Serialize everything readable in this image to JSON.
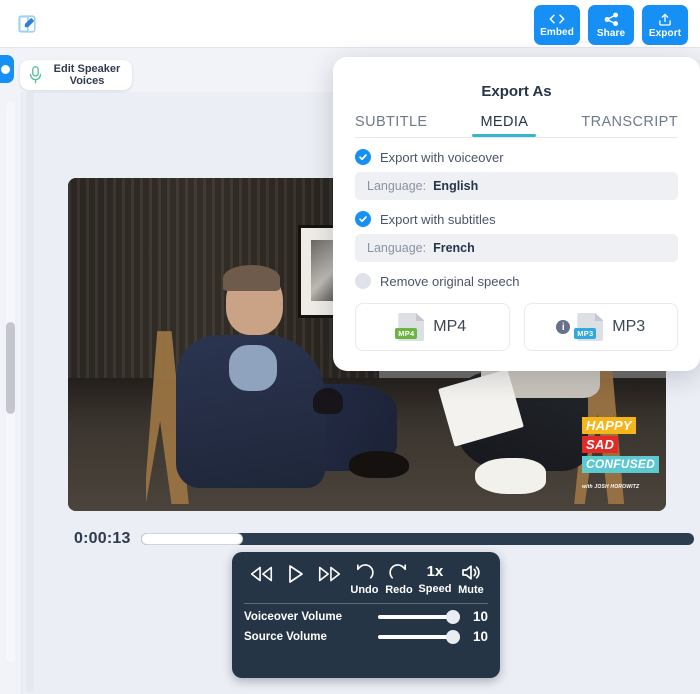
{
  "app": {
    "background_color": "#eceef5",
    "accent_blue": "#1790f5",
    "panel_dark": "#263545",
    "tab_underline": "#39b6cf"
  },
  "topbar": {
    "edit_title_icon": "edit-square-icon",
    "actions": [
      {
        "label": "Embed",
        "icon": "code-icon"
      },
      {
        "label": "Share",
        "icon": "share-nodes-icon"
      },
      {
        "label": "Export",
        "icon": "upload-icon"
      }
    ]
  },
  "secondbar": {
    "edit_speaker_voices": {
      "line1": "Edit Speaker",
      "line2": "Voices",
      "icon": "microphone-icon"
    }
  },
  "video": {
    "logo": {
      "line1": "HAPPY",
      "line2": "SAD",
      "line3": "CONFUSED",
      "line4": "with JOSH HOROWITZ"
    }
  },
  "timeline": {
    "current_time": "0:00:13",
    "progress_percent": 18.5
  },
  "player": {
    "buttons": [
      {
        "name": "rewind",
        "label": "",
        "icon": "rewind-icon"
      },
      {
        "name": "play",
        "label": "",
        "icon": "play-icon"
      },
      {
        "name": "fast-forward",
        "label": "",
        "icon": "fast-forward-icon"
      },
      {
        "name": "undo",
        "label": "Undo",
        "icon": "undo-icon"
      },
      {
        "name": "redo",
        "label": "Redo",
        "icon": "redo-icon"
      },
      {
        "name": "speed",
        "label": "Speed",
        "value": "1x"
      },
      {
        "name": "mute",
        "label": "Mute",
        "icon": "speaker-icon"
      }
    ],
    "sliders": [
      {
        "label": "Voiceover Volume",
        "value": "10",
        "percent": 100
      },
      {
        "label": "Source Volume",
        "value": "10",
        "percent": 100
      }
    ]
  },
  "export_popover": {
    "title": "Export As",
    "tabs": [
      {
        "label": "SUBTITLE",
        "active": false
      },
      {
        "label": "MEDIA",
        "active": true
      },
      {
        "label": "TRANSCRIPT",
        "active": false
      }
    ],
    "options": [
      {
        "label": "Export with voiceover",
        "checked": true,
        "language_key": "Language:",
        "language_value": "English"
      },
      {
        "label": "Export with subtitles",
        "checked": true,
        "language_key": "Language:",
        "language_value": "French"
      }
    ],
    "remove_original_speech": {
      "label": "Remove original speech",
      "checked": false
    },
    "formats": [
      {
        "label": "MP4",
        "tag": "MP4",
        "has_info": false,
        "tag_color": "#6cb544"
      },
      {
        "label": "MP3",
        "tag": "MP3",
        "has_info": true,
        "info_glyph": "i",
        "tag_color": "#31a8e0"
      }
    ]
  }
}
